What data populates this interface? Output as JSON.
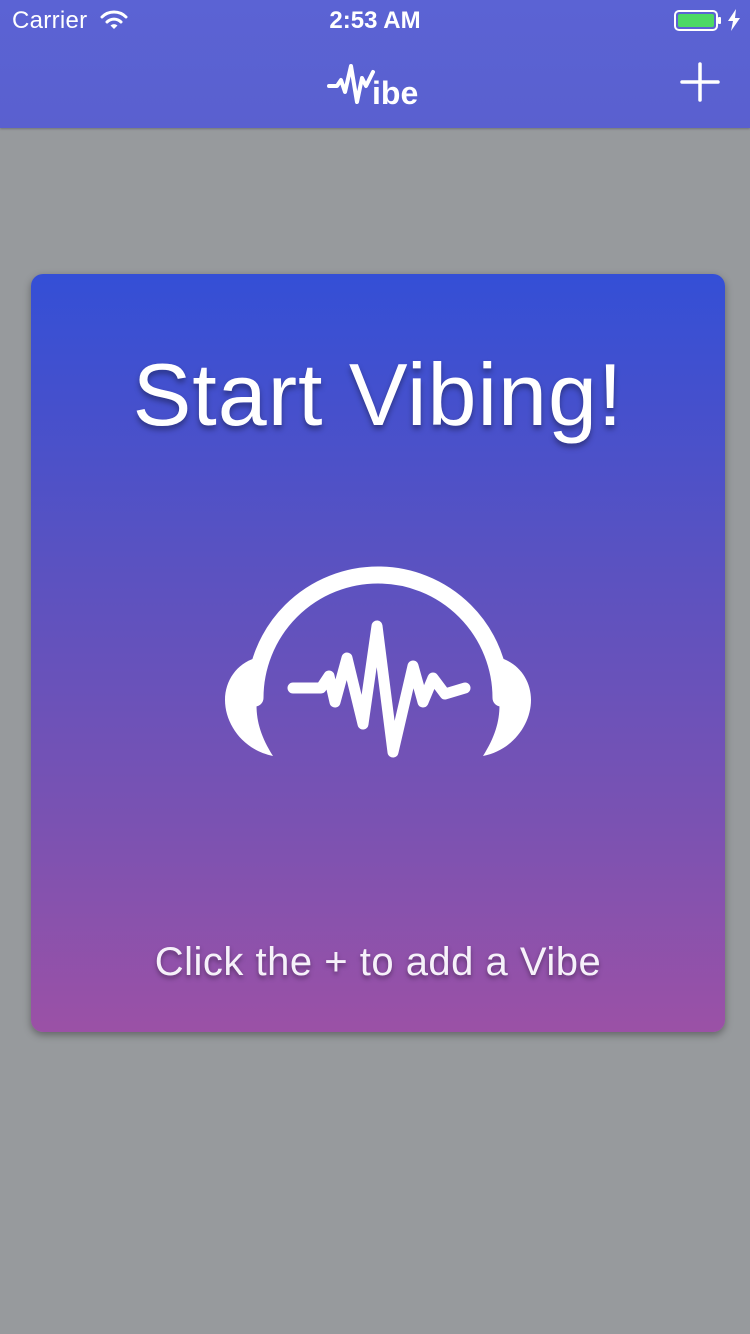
{
  "status_bar": {
    "carrier": "Carrier",
    "time": "2:53 AM",
    "icons": [
      "wifi-icon",
      "battery-icon",
      "charging-icon"
    ],
    "battery_color": "#4cd964"
  },
  "nav_bar": {
    "logo_text": "ibe",
    "add_icon": "plus-icon",
    "background_color": "#5a61d1"
  },
  "card": {
    "title": "Start Vibing!",
    "icon": "headphones-waveform-icon",
    "hint": "Click the + to add a Vibe",
    "gradient_top": "#344fd6",
    "gradient_bottom": "#9b51a6"
  },
  "page": {
    "background_color": "#979a9d"
  }
}
